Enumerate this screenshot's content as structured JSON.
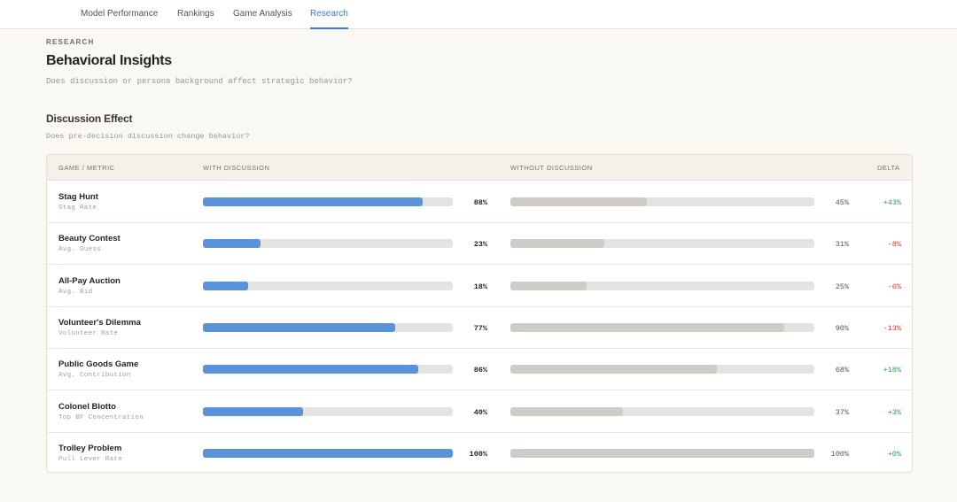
{
  "nav": {
    "tabs": [
      {
        "label": "Model Performance",
        "active": false
      },
      {
        "label": "Rankings",
        "active": false
      },
      {
        "label": "Game Analysis",
        "active": false
      },
      {
        "label": "Research",
        "active": true
      }
    ]
  },
  "header": {
    "eyebrow": "RESEARCH",
    "title": "Behavioral Insights",
    "subtitle": "Does discussion or persona background affect strategic behavior?"
  },
  "section": {
    "title": "Discussion Effect",
    "subtitle": "Does pre-decision discussion change behavior?"
  },
  "table": {
    "columns": {
      "game": "GAME / METRIC",
      "with": "WITH DISCUSSION",
      "without": "WITHOUT DISCUSSION",
      "delta": "DELTA"
    },
    "rows": [
      {
        "game": "Stag Hunt",
        "metric": "Stag Rate",
        "with": 88,
        "with_label": "88%",
        "without": 45,
        "without_label": "45%",
        "delta": "+43%",
        "dir": "pos"
      },
      {
        "game": "Beauty Contest",
        "metric": "Avg. Guess",
        "with": 23,
        "with_label": "23%",
        "without": 31,
        "without_label": "31%",
        "delta": "-8%",
        "dir": "neg"
      },
      {
        "game": "All-Pay Auction",
        "metric": "Avg. Bid",
        "with": 18,
        "with_label": "18%",
        "without": 25,
        "without_label": "25%",
        "delta": "-6%",
        "dir": "neg"
      },
      {
        "game": "Volunteer's Dilemma",
        "metric": "Volunteer Rate",
        "with": 77,
        "with_label": "77%",
        "without": 90,
        "without_label": "90%",
        "delta": "-13%",
        "dir": "neg"
      },
      {
        "game": "Public Goods Game",
        "metric": "Avg. Contribution",
        "with": 86,
        "with_label": "86%",
        "without": 68,
        "without_label": "68%",
        "delta": "+18%",
        "dir": "pos"
      },
      {
        "game": "Colonel Blotto",
        "metric": "Top BF Concentration",
        "with": 40,
        "with_label": "40%",
        "without": 37,
        "without_label": "37%",
        "delta": "+3%",
        "dir": "pos"
      },
      {
        "game": "Trolley Problem",
        "metric": "Pull Lever Rate",
        "with": 100,
        "with_label": "100%",
        "without": 100,
        "without_label": "100%",
        "delta": "+0%",
        "dir": "pos"
      }
    ]
  }
}
